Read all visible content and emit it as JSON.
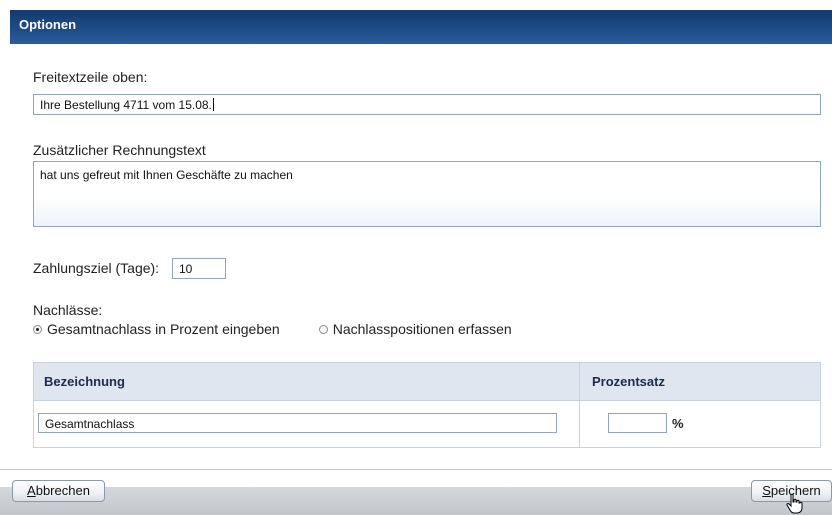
{
  "dialog": {
    "title": "Optionen"
  },
  "free_text_top": {
    "label": "Freitextzeile oben:",
    "value": "Ihre Bestellung 4711 vom 15.08."
  },
  "invoice_text": {
    "label": "Zusätzlicher Rechnungstext",
    "value": "hat uns gefreut mit Ihnen Geschäfte zu machen"
  },
  "payment_term": {
    "label": "Zahlungsziel (Tage):",
    "value": "10"
  },
  "discounts": {
    "label": "Nachlässe:",
    "options": [
      {
        "label": "Gesamtnachlass in Prozent eingeben",
        "selected": true
      },
      {
        "label": "Nachlasspositionen erfassen",
        "selected": false
      }
    ]
  },
  "table": {
    "headers": [
      "Bezeichnung",
      "Prozentsatz"
    ],
    "rows": [
      {
        "bezeichnung": "Gesamtnachlass",
        "prozentsatz": "",
        "unit": "%"
      }
    ]
  },
  "buttons": {
    "cancel_accel": "A",
    "cancel_rest": "bbrechen",
    "save_accel": "S",
    "save_rest": "peichern"
  },
  "colors": {
    "title_bar": "#1d4b87",
    "field_border": "#8fa5c4",
    "table_header": "#dfe6ef"
  },
  "icons": {
    "cursor": "hand-pointer-icon"
  }
}
